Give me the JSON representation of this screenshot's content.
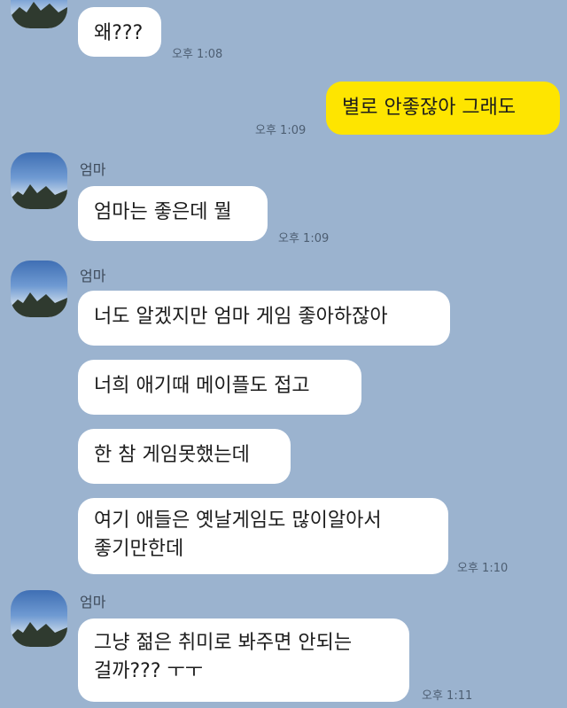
{
  "messages": [
    {
      "sender": "",
      "text": "왜???",
      "time": "오후 1:08"
    },
    {
      "sender": "me",
      "text": "별로 안좋잖아 그래도",
      "time": "오후 1:09"
    },
    {
      "sender": "엄마",
      "text": "엄마는 좋은데 뭘",
      "time": "오후 1:09"
    },
    {
      "sender": "엄마",
      "texts": [
        "너도 알겠지만 엄마 게임 좋아하잖아",
        "너희 애기때 메이플도 접고",
        "한 참 게임못했는데",
        "여기 애들은 옛날게임도 많이알아서",
        "좋기만한데"
      ],
      "time": "오후 1:10"
    },
    {
      "sender": "엄마",
      "texts": [
        "그냥 젊은 취미로 봐주면 안되는",
        "걸까??? ㅜㅜ"
      ],
      "time": "오후 1:11"
    }
  ]
}
